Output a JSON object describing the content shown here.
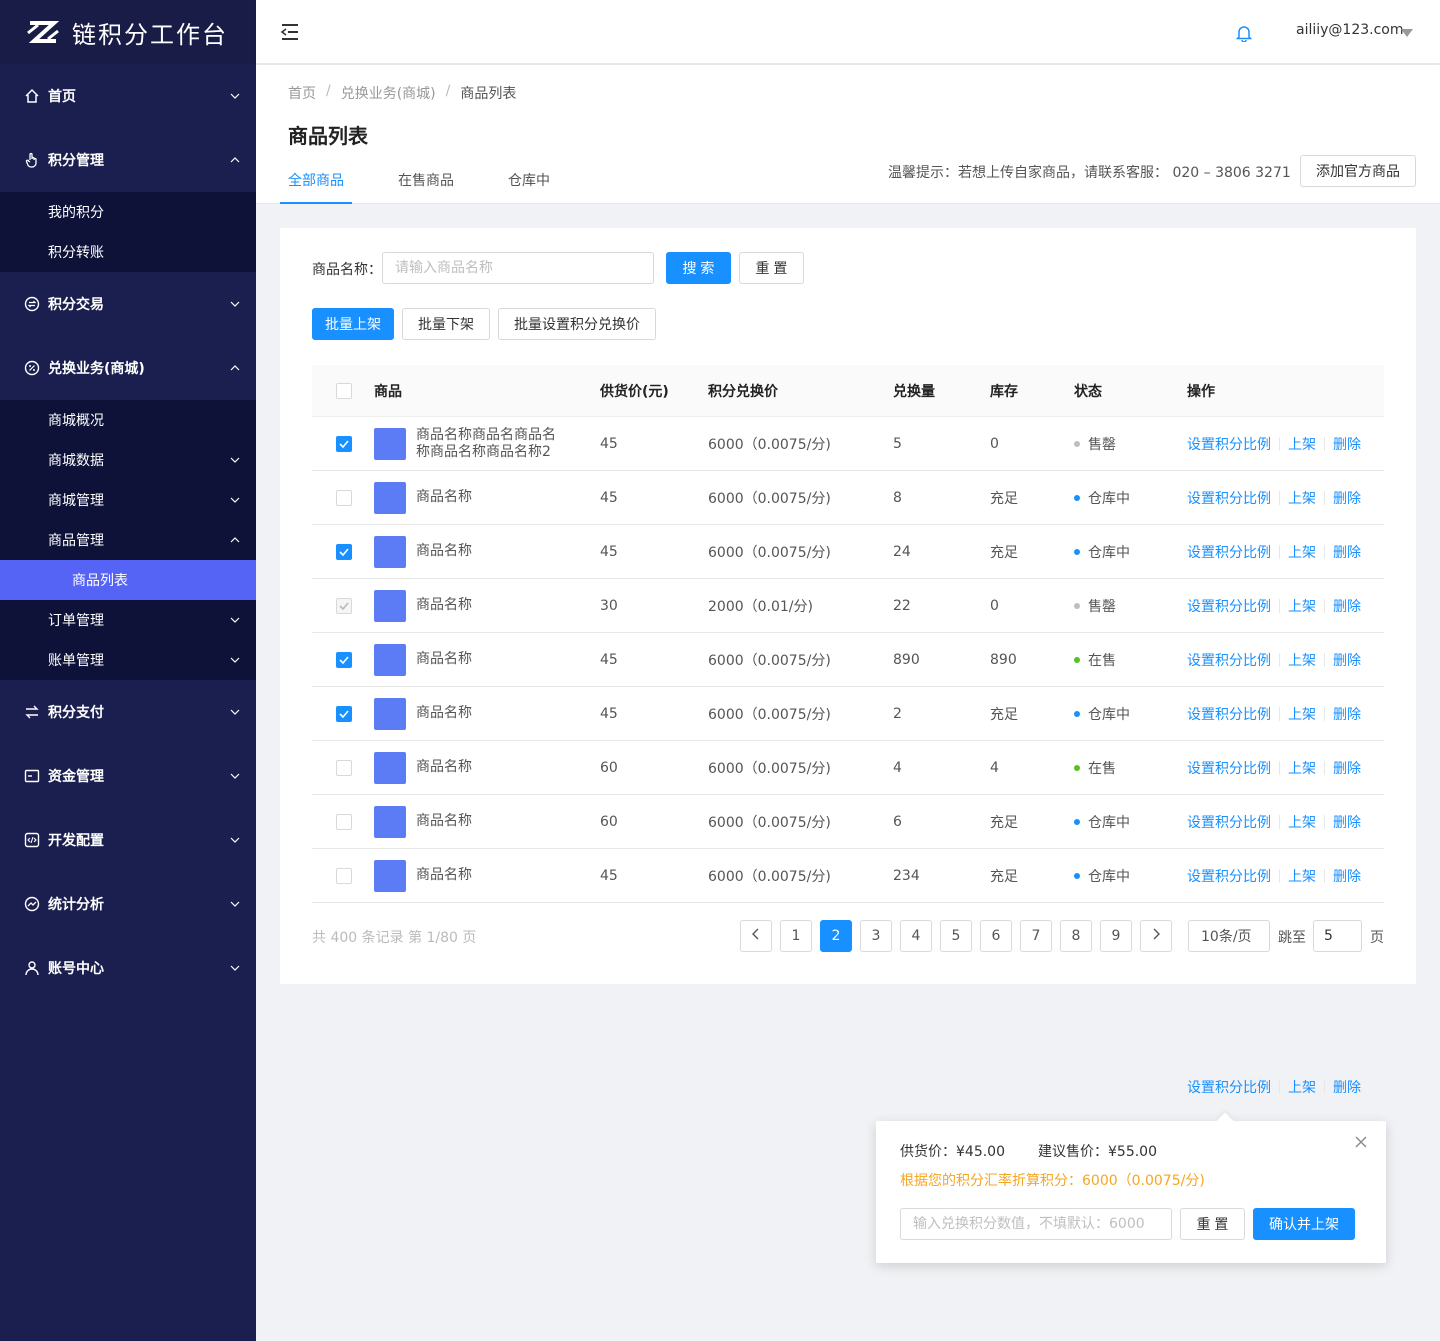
{
  "app": {
    "title": "链积分工作台"
  },
  "sidebar": {
    "menu": [
      {
        "key": "home",
        "label": "首页",
        "icon": "home-icon",
        "expanded": false
      },
      {
        "key": "points",
        "label": "积分管理",
        "icon": "hand-pointer-icon",
        "expanded": true,
        "children": [
          {
            "label": "我的积分"
          },
          {
            "label": "积分转账"
          }
        ]
      },
      {
        "key": "trade",
        "label": "积分交易",
        "icon": "exchange-circle-icon",
        "expanded": false
      },
      {
        "key": "mall",
        "label": "兑换业务(商城)",
        "icon": "percent-circle-icon",
        "expanded": true,
        "children": [
          {
            "label": "商城概况",
            "has_children": false
          },
          {
            "label": "商城数据",
            "has_children": true
          },
          {
            "label": "商城管理",
            "has_children": true
          },
          {
            "label": "商品管理",
            "has_children": true,
            "expanded": true,
            "children": [
              {
                "label": "商品列表",
                "active": true
              }
            ]
          },
          {
            "label": "订单管理",
            "has_children": true
          },
          {
            "label": "账单管理",
            "has_children": true
          }
        ]
      },
      {
        "key": "pay",
        "label": "积分支付",
        "icon": "transfer-arrows-icon",
        "expanded": false
      },
      {
        "key": "fund",
        "label": "资金管理",
        "icon": "wallet-icon",
        "expanded": false
      },
      {
        "key": "dev",
        "label": "开发配置",
        "icon": "code-icon",
        "expanded": false
      },
      {
        "key": "stats",
        "label": "统计分析",
        "icon": "chart-circle-icon",
        "expanded": false
      },
      {
        "key": "account",
        "label": "账号中心",
        "icon": "user-icon",
        "expanded": false
      }
    ]
  },
  "header": {
    "user_email": "ailiiy@123.com"
  },
  "breadcrumb": [
    "首页",
    "兑换业务(商城)",
    "商品列表"
  ],
  "page_title": "商品列表",
  "tabs": [
    {
      "label": "全部商品",
      "active": true
    },
    {
      "label": "在售商品",
      "active": false
    },
    {
      "label": "仓库中",
      "active": false
    }
  ],
  "notice": "温馨提示：若想上传自家商品，请联系客服： 020 – 3806 3271",
  "add_official_label": "添加官方商品",
  "search": {
    "label": "商品名称：",
    "placeholder": "请输入商品名称",
    "value": "",
    "search_label": "搜 索",
    "reset_label": "重 置"
  },
  "batch": {
    "on_shelf": "批量上架",
    "off_shelf": "批量下架",
    "set_price": "批量设置积分兑换价"
  },
  "table": {
    "columns": [
      "商品",
      "供货价(元)",
      "积分兑换价",
      "兑换量",
      "库存",
      "状态",
      "操作"
    ],
    "rows": [
      {
        "checked": true,
        "disabled": false,
        "name": "商品名称商品名商品名称商品名称商品名称2",
        "price": "45",
        "points": "6000（0.0075/分)",
        "qty": "5",
        "stock": "0",
        "status": "售罄",
        "status_color": "#bfbfbf"
      },
      {
        "checked": false,
        "disabled": false,
        "name": "商品名称",
        "price": "45",
        "points": "6000（0.0075/分)",
        "qty": "8",
        "stock": "充足",
        "status": "仓库中",
        "status_color": "#1890ff"
      },
      {
        "checked": true,
        "disabled": false,
        "name": "商品名称",
        "price": "45",
        "points": "6000（0.0075/分)",
        "qty": "24",
        "stock": "充足",
        "status": "仓库中",
        "status_color": "#1890ff"
      },
      {
        "checked": true,
        "disabled": true,
        "name": "商品名称",
        "price": "30",
        "points": "2000（0.01/分)",
        "qty": "22",
        "stock": "0",
        "status": "售罄",
        "status_color": "#bfbfbf"
      },
      {
        "checked": true,
        "disabled": false,
        "name": "商品名称",
        "price": "45",
        "points": "6000（0.0075/分)",
        "qty": "890",
        "stock": "890",
        "status": "在售",
        "status_color": "#52c41a"
      },
      {
        "checked": true,
        "disabled": false,
        "name": "商品名称",
        "price": "45",
        "points": "6000（0.0075/分)",
        "qty": "2",
        "stock": "充足",
        "status": "仓库中",
        "status_color": "#1890ff"
      },
      {
        "checked": false,
        "disabled": false,
        "name": "商品名称",
        "price": "60",
        "points": "6000（0.0075/分)",
        "qty": "4",
        "stock": "4",
        "status": "在售",
        "status_color": "#52c41a"
      },
      {
        "checked": false,
        "disabled": false,
        "name": "商品名称",
        "price": "60",
        "points": "6000（0.0075/分)",
        "qty": "6",
        "stock": "充足",
        "status": "仓库中",
        "status_color": "#1890ff"
      },
      {
        "checked": false,
        "disabled": false,
        "name": "商品名称",
        "price": "45",
        "points": "6000（0.0075/分)",
        "qty": "234",
        "stock": "充足",
        "status": "仓库中",
        "status_color": "#1890ff"
      }
    ],
    "ops": [
      "设置积分比例",
      "上架",
      "删除"
    ]
  },
  "pagination": {
    "total_text": "共 400 条记录 第 1/80 页",
    "pages": [
      "1",
      "2",
      "3",
      "4",
      "5",
      "6",
      "7",
      "8",
      "9"
    ],
    "current": "2",
    "page_size": "10条/页",
    "jump_label": "跳至",
    "jump_value": "5",
    "page_unit": "页"
  },
  "float_ops": [
    "设置积分比例",
    "上架",
    "删除"
  ],
  "popover": {
    "supply_price": "供货价：¥45.00",
    "suggest_price": "建议售价：¥55.00",
    "hint": "根据您的积分汇率折算积分：6000（0.0075/分)",
    "placeholder": "输入兑换积分数值，不填默认：6000",
    "reset_label": "重 置",
    "confirm_label": "确认并上架"
  }
}
